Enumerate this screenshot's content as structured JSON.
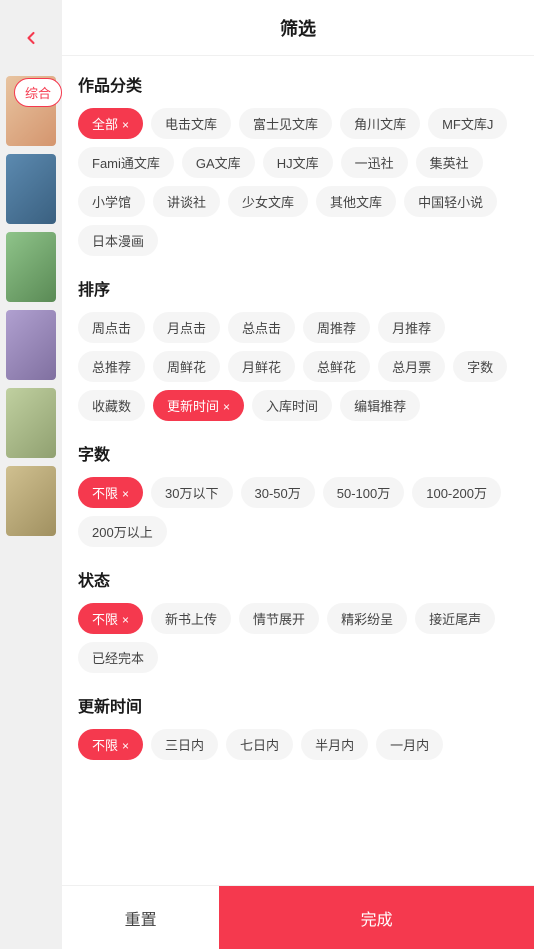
{
  "header": {
    "title": "筛选",
    "back_icon": "←"
  },
  "sidebar": {
    "back_label": "‹",
    "tab_label": "综合"
  },
  "sections": [
    {
      "id": "category",
      "title": "作品分类",
      "tags": [
        {
          "label": "全部",
          "active": true
        },
        {
          "label": "电击文库",
          "active": false
        },
        {
          "label": "富士见文库",
          "active": false
        },
        {
          "label": "角川文库",
          "active": false
        },
        {
          "label": "MF文库J",
          "active": false
        },
        {
          "label": "Fami通文库",
          "active": false
        },
        {
          "label": "GA文库",
          "active": false
        },
        {
          "label": "HJ文库",
          "active": false
        },
        {
          "label": "一迅社",
          "active": false
        },
        {
          "label": "集英社",
          "active": false
        },
        {
          "label": "小学馆",
          "active": false
        },
        {
          "label": "讲谈社",
          "active": false
        },
        {
          "label": "少女文库",
          "active": false
        },
        {
          "label": "其他文库",
          "active": false
        },
        {
          "label": "中国轻小说",
          "active": false
        },
        {
          "label": "日本漫画",
          "active": false
        }
      ]
    },
    {
      "id": "sort",
      "title": "排序",
      "tags": [
        {
          "label": "周点击",
          "active": false
        },
        {
          "label": "月点击",
          "active": false
        },
        {
          "label": "总点击",
          "active": false
        },
        {
          "label": "周推荐",
          "active": false
        },
        {
          "label": "月推荐",
          "active": false
        },
        {
          "label": "总推荐",
          "active": false
        },
        {
          "label": "周鲜花",
          "active": false
        },
        {
          "label": "月鲜花",
          "active": false
        },
        {
          "label": "总鲜花",
          "active": false
        },
        {
          "label": "总月票",
          "active": false
        },
        {
          "label": "字数",
          "active": false
        },
        {
          "label": "收藏数",
          "active": false
        },
        {
          "label": "更新时间",
          "active": true
        },
        {
          "label": "入库时间",
          "active": false
        },
        {
          "label": "编辑推荐",
          "active": false
        }
      ]
    },
    {
      "id": "wordcount",
      "title": "字数",
      "tags": [
        {
          "label": "不限",
          "active": true
        },
        {
          "label": "30万以下",
          "active": false
        },
        {
          "label": "30-50万",
          "active": false
        },
        {
          "label": "50-100万",
          "active": false
        },
        {
          "label": "100-200万",
          "active": false
        },
        {
          "label": "200万以上",
          "active": false
        }
      ]
    },
    {
      "id": "status",
      "title": "状态",
      "tags": [
        {
          "label": "不限",
          "active": true
        },
        {
          "label": "新书上传",
          "active": false
        },
        {
          "label": "情节展开",
          "active": false
        },
        {
          "label": "精彩纷呈",
          "active": false
        },
        {
          "label": "接近尾声",
          "active": false
        },
        {
          "label": "已经完本",
          "active": false
        }
      ]
    },
    {
      "id": "update_time",
      "title": "更新时间",
      "tags": [
        {
          "label": "不限",
          "active": true
        },
        {
          "label": "三日内",
          "active": false
        },
        {
          "label": "七日内",
          "active": false
        },
        {
          "label": "半月内",
          "active": false
        },
        {
          "label": "一月内",
          "active": false
        }
      ]
    }
  ],
  "footer": {
    "reset_label": "重置",
    "confirm_label": "完成"
  },
  "colors": {
    "accent": "#f5394e",
    "tag_active_bg": "#f5394e",
    "tag_active_text": "#fff",
    "tag_default_bg": "#f5f5f5",
    "tag_default_text": "#444"
  }
}
